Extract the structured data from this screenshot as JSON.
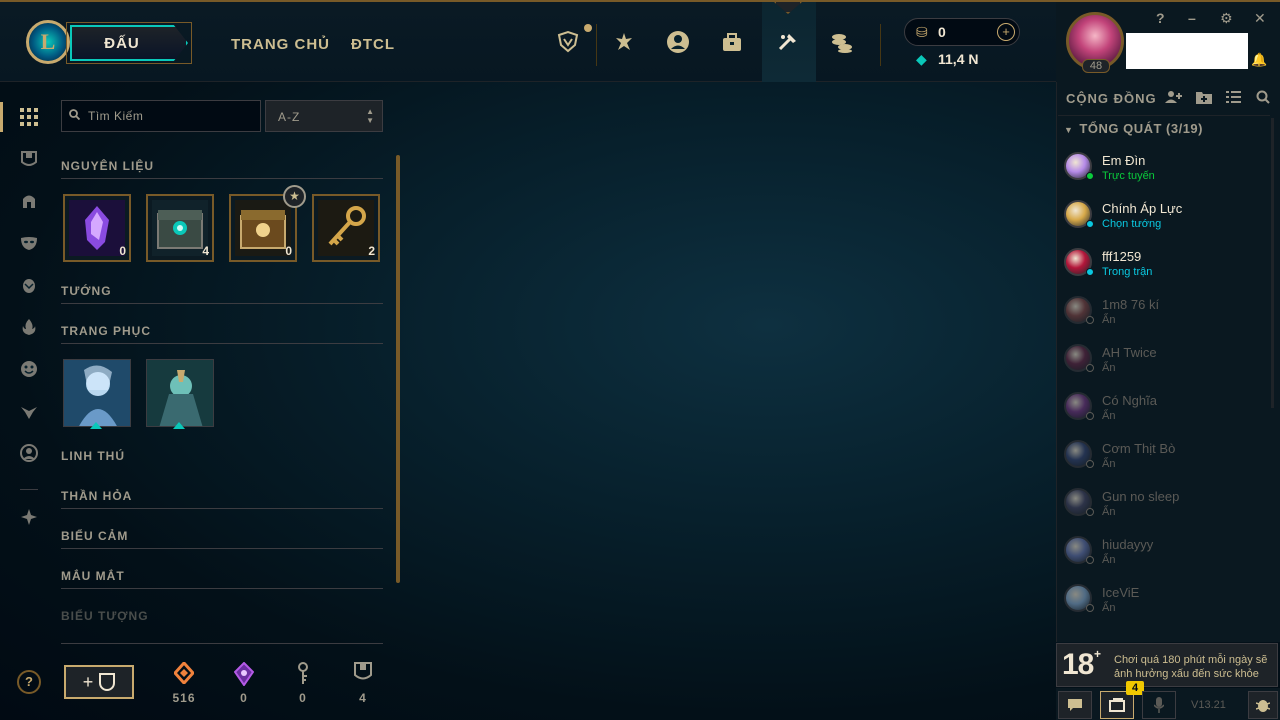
{
  "header": {
    "play_label": "ĐẤU",
    "nav_links": [
      "TRANG CHỦ",
      "ĐTCL"
    ],
    "rp_value": "0",
    "rp_plus": "+",
    "be_value": "11,4 N"
  },
  "profile": {
    "level": "48"
  },
  "window_controls": {
    "help": "?",
    "minimize": "–",
    "settings": "⚙",
    "close": "✕"
  },
  "loot": {
    "search_placeholder": "Tìm Kiếm",
    "sort_value": "A-Z",
    "sections": {
      "materials": "NGUYÊN LIỆU",
      "champions": "TƯỚNG",
      "skins": "TRANG PHỤC",
      "companions": "LINH THÚ",
      "ward_skins": "THẦN HỎA",
      "emotes": "BIỂU CẢM",
      "eye_colors": "MẮU MẮT",
      "icons": "BIỂU TƯỢNG"
    },
    "materials": [
      {
        "name": "mythic-essence",
        "count": "0"
      },
      {
        "name": "hextech-chest",
        "count": "4"
      },
      {
        "name": "masterwork-chest",
        "count": "0"
      },
      {
        "name": "hextech-key",
        "count": "2"
      }
    ],
    "essences": [
      {
        "name": "orange-essence-icon",
        "value": "516",
        "color": "#f0823c"
      },
      {
        "name": "mythic-essence-icon",
        "value": "0",
        "color": "#b45ae6"
      },
      {
        "name": "key-fragment-icon",
        "value": "0",
        "color": "#a09b8c"
      },
      {
        "name": "chest-icon",
        "value": "4",
        "color": "#a09b8c"
      }
    ],
    "craft_plus": "+"
  },
  "social": {
    "title": "CỘNG ĐỒNG",
    "group": "TỔNG QUÁT (3/19)",
    "friends": [
      {
        "name": "Em Đìn",
        "status": "Trực tuyến",
        "state": "online"
      },
      {
        "name": "Chính Áp Lực",
        "status": "Chọn tướng",
        "state": "ingame"
      },
      {
        "name": "fff1259",
        "status": "Trong trận",
        "state": "ingame"
      },
      {
        "name": "1m8 76 kí",
        "status": "Ẩn",
        "state": "offline"
      },
      {
        "name": "AH Twice",
        "status": "Ẩn",
        "state": "offline"
      },
      {
        "name": "Có Nghĩa",
        "status": "Ẩn",
        "state": "offline"
      },
      {
        "name": "Cơm Thịt Bò",
        "status": "Ẩn",
        "state": "offline"
      },
      {
        "name": "Gun no sleep",
        "status": "Ẩn",
        "state": "offline"
      },
      {
        "name": "hiudayyy",
        "status": "Ẩn",
        "state": "offline"
      },
      {
        "name": "IceViE",
        "status": "Ẩn",
        "state": "offline"
      }
    ]
  },
  "warning": {
    "age": "18",
    "plus": "+",
    "text": "Chơi quá 180 phút mỗi ngày sẽ ảnh hưởng xấu đến sức khỏe"
  },
  "footer": {
    "notification_count": "4",
    "version": "V13.21"
  },
  "colors": {
    "gold": "#c8aa6e",
    "teal": "#0ac8b9",
    "online": "#0acb3c",
    "ingame": "#0ac8e0",
    "offline": "#5b5a56"
  }
}
